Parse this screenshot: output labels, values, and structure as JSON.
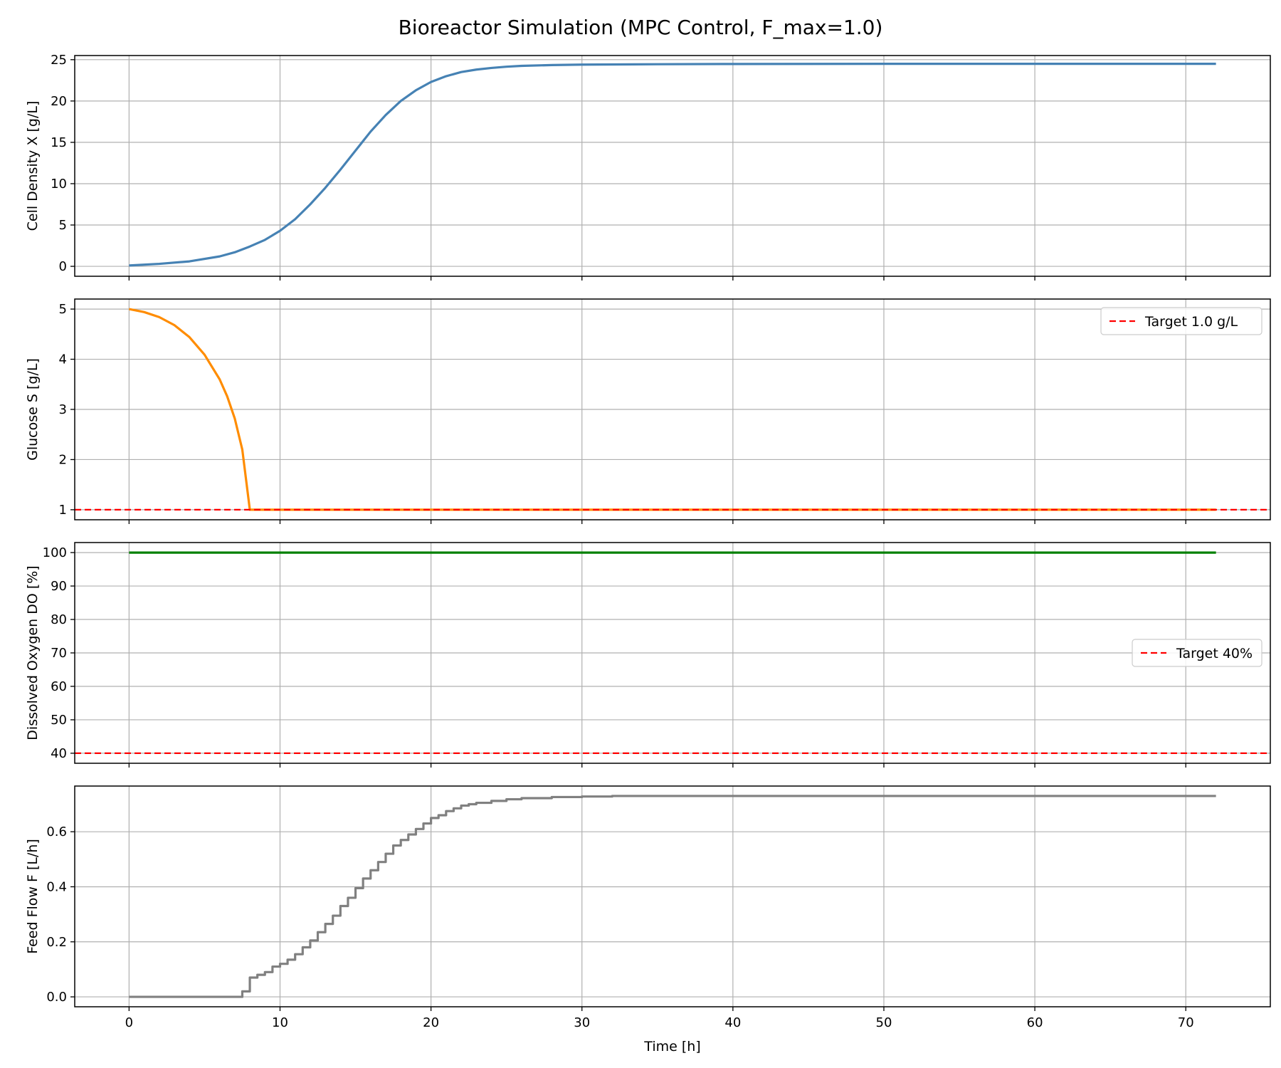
{
  "figure_title": "Bioreactor Simulation (MPC Control, F_max=1.0)",
  "chart_data": [
    {
      "type": "line",
      "ylabel": "Cell Density X [g/L]",
      "xlim": [
        -3.6,
        75.6
      ],
      "ylim": [
        -1.2,
        25.5
      ],
      "xticks": [
        0,
        10,
        20,
        30,
        40,
        50,
        60,
        70
      ],
      "yticks": [
        0,
        5,
        10,
        15,
        20,
        25
      ],
      "show_x_ticklabels": false,
      "grid": true,
      "series": [
        {
          "color": "#4682b4",
          "style": "solid",
          "x": [
            0,
            2,
            4,
            6,
            7,
            8,
            9,
            10,
            11,
            12,
            13,
            14,
            15,
            16,
            17,
            18,
            19,
            20,
            21,
            22,
            23,
            24,
            25,
            26,
            28,
            30,
            35,
            40,
            50,
            60,
            72
          ],
          "y": [
            0.1,
            0.3,
            0.6,
            1.2,
            1.7,
            2.4,
            3.2,
            4.3,
            5.7,
            7.5,
            9.5,
            11.7,
            14.0,
            16.3,
            18.3,
            20.0,
            21.3,
            22.3,
            23.0,
            23.5,
            23.8,
            24.0,
            24.15,
            24.25,
            24.35,
            24.4,
            24.45,
            24.48,
            24.5,
            24.5,
            24.5
          ]
        }
      ]
    },
    {
      "type": "line",
      "ylabel": "Glucose S [g/L]",
      "xlim": [
        -3.6,
        75.6
      ],
      "ylim": [
        0.8,
        5.2
      ],
      "xticks": [
        0,
        10,
        20,
        30,
        40,
        50,
        60,
        70
      ],
      "yticks": [
        1,
        2,
        3,
        4,
        5
      ],
      "show_x_ticklabels": false,
      "grid": true,
      "legend": {
        "position": "upper right",
        "entries": [
          {
            "label": "Target 1.0 g/L",
            "color": "#ff0000",
            "style": "dashed"
          }
        ]
      },
      "series": [
        {
          "color": "#ff8c00",
          "style": "solid",
          "x": [
            0,
            1,
            2,
            3,
            4,
            5,
            6,
            6.5,
            7,
            7.5,
            8,
            10,
            20,
            30,
            40,
            50,
            60,
            72
          ],
          "y": [
            5.0,
            4.94,
            4.84,
            4.68,
            4.44,
            4.09,
            3.6,
            3.26,
            2.82,
            2.2,
            1.0,
            1.0,
            1.0,
            1.0,
            1.0,
            1.0,
            1.0,
            1.0
          ]
        },
        {
          "name": "Target 1.0 g/L",
          "color": "#ff0000",
          "style": "dashed",
          "full_width": true,
          "x": [
            -3.6,
            75.6
          ],
          "y": [
            1.0,
            1.0
          ]
        }
      ]
    },
    {
      "type": "line",
      "ylabel": "Dissolved Oxygen DO [%]",
      "xlim": [
        -3.6,
        75.6
      ],
      "ylim": [
        37,
        103
      ],
      "xticks": [
        0,
        10,
        20,
        30,
        40,
        50,
        60,
        70
      ],
      "yticks": [
        40,
        50,
        60,
        70,
        80,
        90,
        100
      ],
      "show_x_ticklabels": false,
      "grid": true,
      "legend": {
        "position": "center right",
        "entries": [
          {
            "label": "Target 40%",
            "color": "#ff0000",
            "style": "dashed"
          }
        ]
      },
      "series": [
        {
          "color": "#008000",
          "style": "solid",
          "x": [
            0,
            72
          ],
          "y": [
            100,
            100
          ]
        },
        {
          "name": "Target 40%",
          "color": "#ff0000",
          "style": "dashed",
          "full_width": true,
          "x": [
            -3.6,
            75.6
          ],
          "y": [
            40,
            40
          ]
        }
      ]
    },
    {
      "type": "line",
      "ylabel": "Feed Flow F [L/h]",
      "xlabel": "Time [h]",
      "xlim": [
        -3.6,
        75.6
      ],
      "ylim": [
        -0.036,
        0.766
      ],
      "xticks": [
        0,
        10,
        20,
        30,
        40,
        50,
        60,
        70
      ],
      "yticks": [
        0.0,
        0.2,
        0.4,
        0.6
      ],
      "ytick_labels": [
        "0.0",
        "0.2",
        "0.4",
        "0.6"
      ],
      "show_x_ticklabels": true,
      "grid": true,
      "series": [
        {
          "color": "#808080",
          "style": "step",
          "x": [
            0,
            7.5,
            8,
            8.5,
            9,
            9.5,
            10,
            10.5,
            11,
            11.5,
            12,
            12.5,
            13,
            13.5,
            14,
            14.5,
            15,
            15.5,
            16,
            16.5,
            17,
            17.5,
            18,
            18.5,
            19,
            19.5,
            20,
            20.5,
            21,
            21.5,
            22,
            22.5,
            23,
            24,
            25,
            26,
            28,
            30,
            32,
            72
          ],
          "y": [
            0.0,
            0.02,
            0.07,
            0.08,
            0.09,
            0.11,
            0.12,
            0.135,
            0.155,
            0.18,
            0.205,
            0.235,
            0.265,
            0.295,
            0.33,
            0.36,
            0.395,
            0.43,
            0.46,
            0.49,
            0.52,
            0.55,
            0.57,
            0.59,
            0.61,
            0.63,
            0.65,
            0.66,
            0.675,
            0.685,
            0.695,
            0.7,
            0.705,
            0.712,
            0.718,
            0.722,
            0.726,
            0.728,
            0.73,
            0.73
          ]
        }
      ]
    }
  ]
}
